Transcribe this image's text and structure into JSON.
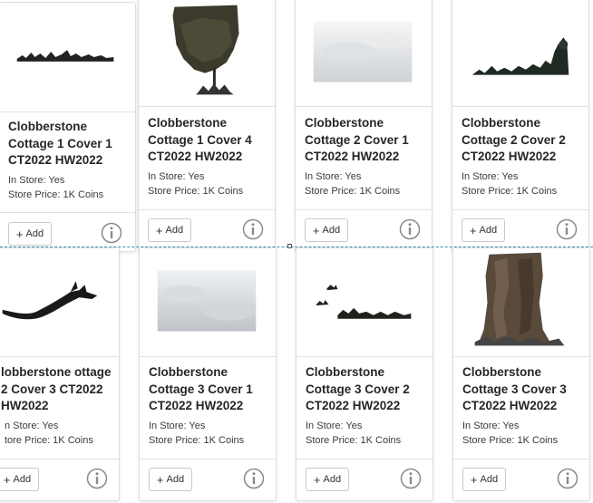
{
  "cards": [
    {
      "title": "Clobberstone Cottage 1 Cover 1 CT2022 HW2022",
      "in_store": "In Store: Yes",
      "store_price": "Store Price: 1K Coins",
      "add_label": "Add"
    },
    {
      "title": "Clobberstone Cottage 1 Cover 4 CT2022 HW2022",
      "in_store": "In Store: Yes",
      "store_price": "Store Price: 1K Coins",
      "add_label": "Add"
    },
    {
      "title": "Clobberstone Cottage 2 Cover 1 CT2022 HW2022",
      "in_store": "In Store: Yes",
      "store_price": "Store Price: 1K Coins",
      "add_label": "Add"
    },
    {
      "title": "Clobberstone Cottage 2 Cover 2 CT2022 HW2022",
      "in_store": "In Store: Yes",
      "store_price": "Store Price: 1K Coins",
      "add_label": "Add"
    },
    {
      "title": "lobberstone ottage 2 Cover 3 CT2022 HW2022",
      "in_store": "n Store: Yes",
      "store_price": "tore Price: 1K Coins",
      "add_label": "Add"
    },
    {
      "title": "Clobberstone Cottage 3 Cover 1 CT2022 HW2022",
      "in_store": "In Store: Yes",
      "store_price": "Store Price: 1K Coins",
      "add_label": "Add"
    },
    {
      "title": "Clobberstone Cottage 3 Cover 2 CT2022 HW2022",
      "in_store": "In Store: Yes",
      "store_price": "Store Price: 1K Coins",
      "add_label": "Add"
    },
    {
      "title": "Clobberstone Cottage 3 Cover 3 CT2022 HW2022",
      "in_store": "In Store: Yes",
      "store_price": "Store Price: 1K Coins",
      "add_label": "Add"
    }
  ],
  "icons": {
    "add": "plus-icon",
    "info": "info-icon"
  },
  "colors": {
    "card_border": "#dedede",
    "divider": "#3a8fb0",
    "text": "#262626"
  }
}
